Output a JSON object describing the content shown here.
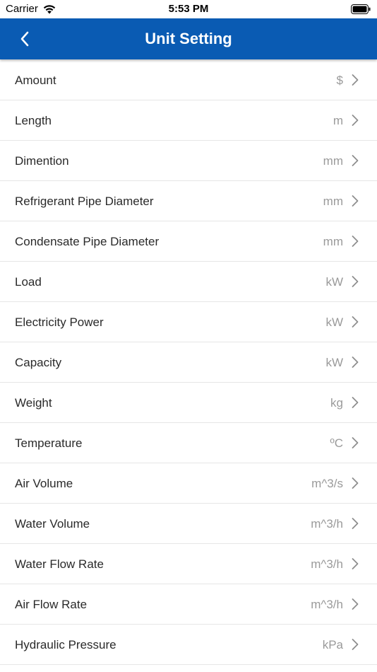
{
  "status_bar": {
    "carrier": "Carrier",
    "time": "5:53 PM"
  },
  "nav": {
    "title": "Unit Setting",
    "back_icon": "chevron-left-icon"
  },
  "colors": {
    "nav_background": "#0a5bb3",
    "value_text": "#9a9a9a",
    "label_text": "#2a2a2a",
    "divider": "#e6e6e6"
  },
  "settings": [
    {
      "label": "Amount",
      "value": "$"
    },
    {
      "label": "Length",
      "value": "m"
    },
    {
      "label": "Dimention",
      "value": "mm"
    },
    {
      "label": "Refrigerant Pipe Diameter",
      "value": "mm"
    },
    {
      "label": "Condensate Pipe Diameter",
      "value": "mm"
    },
    {
      "label": "Load",
      "value": "kW"
    },
    {
      "label": "Electricity Power",
      "value": "kW"
    },
    {
      "label": "Capacity",
      "value": "kW"
    },
    {
      "label": "Weight",
      "value": "kg"
    },
    {
      "label": "Temperature",
      "value": "ºC"
    },
    {
      "label": "Air Volume",
      "value": "m^3/s"
    },
    {
      "label": "Water Volume",
      "value": "m^3/h"
    },
    {
      "label": "Water Flow Rate",
      "value": "m^3/h"
    },
    {
      "label": "Air Flow Rate",
      "value": "m^3/h"
    },
    {
      "label": "Hydraulic Pressure",
      "value": "kPa"
    }
  ]
}
